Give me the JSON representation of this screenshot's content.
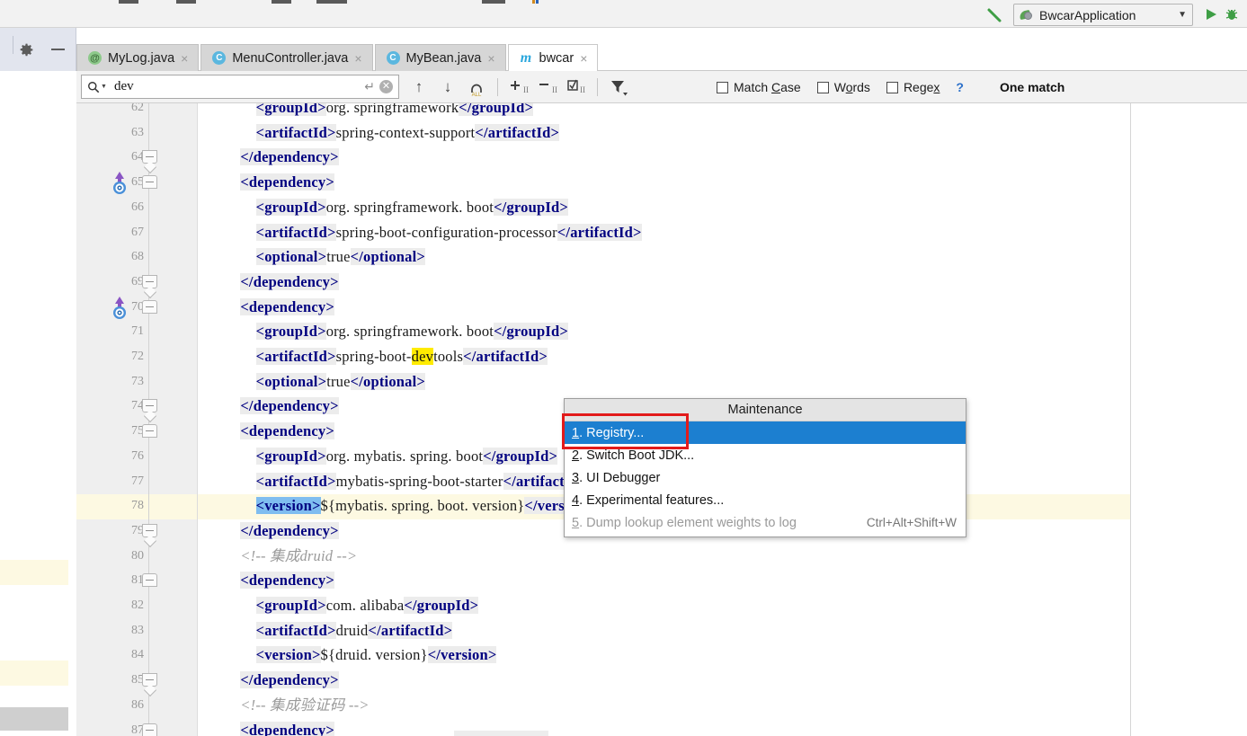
{
  "window": {
    "run_config": "BwcarApplication",
    "run_config_icon": "spring-leaf-icon",
    "hammer_icon": "build-hammer-icon",
    "run_icon": "run-play-icon",
    "debug_icon": "debug-bug-icon",
    "dropdown_icon": "chevron-down-icon"
  },
  "tool_gutter": {
    "settings_icon": "gear-icon",
    "hide_icon": "minimize-icon"
  },
  "tabs": [
    {
      "label": "MyLog.java",
      "icon": "annotation-icon",
      "icon_glyph": "@",
      "icon_kind": "ann",
      "active": false,
      "close": "×"
    },
    {
      "label": "MenuController.java",
      "icon": "class-icon",
      "icon_glyph": "C",
      "icon_kind": "cls",
      "active": false,
      "close": "×"
    },
    {
      "label": "MyBean.java",
      "icon": "class-icon",
      "icon_glyph": "C",
      "icon_kind": "cls",
      "active": false,
      "close": "×"
    },
    {
      "label": "bwcar",
      "icon": "maven-icon",
      "icon_glyph": "m",
      "icon_kind": "mvn",
      "active": true,
      "close": "×"
    }
  ],
  "find": {
    "query": "dev",
    "placeholder": "",
    "search_icon": "search-icon",
    "history_icon": "chevron-down-icon",
    "enter_icon": "enter-return-icon",
    "clear_icon": "clear-close-icon",
    "prev_label": "↑",
    "next_label": "↓",
    "find_all_label": "ALL",
    "buttons": [
      {
        "name": "find-previous-button",
        "glyph": "↑"
      },
      {
        "name": "find-next-button",
        "glyph": "↓"
      },
      {
        "name": "find-all-button",
        "glyph": "⭘"
      },
      {
        "name": "add-selection-button",
        "glyph": "+"
      },
      {
        "name": "remove-selection-button",
        "glyph": "−"
      },
      {
        "name": "select-all-occurrences-button",
        "glyph": "☑"
      },
      {
        "name": "filter-button",
        "glyph": "▼"
      }
    ],
    "options": [
      {
        "label_pre": "Match ",
        "accel": "C",
        "label_post": "ase",
        "checked": false,
        "name": "match-case-checkbox"
      },
      {
        "label_pre": "W",
        "accel": "o",
        "label_post": "rds",
        "checked": false,
        "name": "words-checkbox"
      },
      {
        "label_pre": "Rege",
        "accel": "x",
        "label_post": "",
        "checked": false,
        "name": "regex-checkbox"
      }
    ],
    "help_label": "?",
    "status": "One match"
  },
  "editor": {
    "first_line": 62,
    "lines": [
      {
        "n": 62,
        "parts": [
          {
            "t": "tx",
            "s": "        "
          },
          {
            "t": "tg",
            "s": "<groupId>"
          },
          {
            "t": "tx",
            "s": "org. springframework"
          },
          {
            "t": "tg",
            "s": "</groupId>"
          }
        ]
      },
      {
        "n": 63,
        "parts": [
          {
            "t": "tx",
            "s": "        "
          },
          {
            "t": "tg",
            "s": "<artifactId>"
          },
          {
            "t": "tx",
            "s": "spring-context-support"
          },
          {
            "t": "tg",
            "s": "</artifactId>"
          }
        ]
      },
      {
        "n": 64,
        "fold": "bot",
        "parts": [
          {
            "t": "tx",
            "s": "    "
          },
          {
            "t": "tg",
            "s": "</dependency>"
          }
        ]
      },
      {
        "n": 65,
        "fold": "top",
        "gmark": "spring-bean-marker",
        "parts": [
          {
            "t": "tx",
            "s": "    "
          },
          {
            "t": "tg",
            "s": "<dependency>"
          }
        ]
      },
      {
        "n": 66,
        "parts": [
          {
            "t": "tx",
            "s": "        "
          },
          {
            "t": "tg",
            "s": "<groupId>"
          },
          {
            "t": "tx",
            "s": "org. springframework. boot"
          },
          {
            "t": "tg",
            "s": "</groupId>"
          }
        ]
      },
      {
        "n": 67,
        "parts": [
          {
            "t": "tx",
            "s": "        "
          },
          {
            "t": "tg",
            "s": "<artifactId>"
          },
          {
            "t": "tx",
            "s": "spring-boot-configuration-processor"
          },
          {
            "t": "tg",
            "s": "</artifactId>"
          }
        ]
      },
      {
        "n": 68,
        "parts": [
          {
            "t": "tx",
            "s": "        "
          },
          {
            "t": "tg",
            "s": "<optional>"
          },
          {
            "t": "tx",
            "s": "true"
          },
          {
            "t": "tg",
            "s": "</optional>"
          }
        ]
      },
      {
        "n": 69,
        "fold": "bot",
        "parts": [
          {
            "t": "tx",
            "s": "    "
          },
          {
            "t": "tg",
            "s": "</dependency>"
          }
        ]
      },
      {
        "n": 70,
        "fold": "top",
        "gmark": "spring-bean-marker",
        "parts": [
          {
            "t": "tx",
            "s": "    "
          },
          {
            "t": "tg",
            "s": "<dependency>"
          }
        ]
      },
      {
        "n": 71,
        "parts": [
          {
            "t": "tx",
            "s": "        "
          },
          {
            "t": "tg",
            "s": "<groupId>"
          },
          {
            "t": "tx",
            "s": "org. springframework. boot"
          },
          {
            "t": "tg",
            "s": "</groupId>"
          }
        ]
      },
      {
        "n": 72,
        "parts": [
          {
            "t": "tx",
            "s": "        "
          },
          {
            "t": "tg",
            "s": "<artifactId>"
          },
          {
            "t": "tx",
            "s": "spring-boot-"
          },
          {
            "t": "hitmark",
            "s": "dev"
          },
          {
            "t": "tx",
            "s": "tools"
          },
          {
            "t": "tg",
            "s": "</artifactId>"
          }
        ]
      },
      {
        "n": 73,
        "parts": [
          {
            "t": "tx",
            "s": "        "
          },
          {
            "t": "tg",
            "s": "<optional>"
          },
          {
            "t": "tx",
            "s": "true"
          },
          {
            "t": "tg",
            "s": "</optional>"
          }
        ]
      },
      {
        "n": 74,
        "fold": "bot",
        "parts": [
          {
            "t": "tx",
            "s": "    "
          },
          {
            "t": "tg",
            "s": "</dependency>"
          }
        ]
      },
      {
        "n": 75,
        "fold": "top",
        "parts": [
          {
            "t": "tx",
            "s": "    "
          },
          {
            "t": "tg",
            "s": "<dependency>"
          }
        ]
      },
      {
        "n": 76,
        "parts": [
          {
            "t": "tx",
            "s": "        "
          },
          {
            "t": "tg",
            "s": "<groupId>"
          },
          {
            "t": "tx",
            "s": "org. mybatis. spring. boot"
          },
          {
            "t": "tg",
            "s": "</groupId>"
          }
        ]
      },
      {
        "n": 77,
        "parts": [
          {
            "t": "tx",
            "s": "        "
          },
          {
            "t": "tg",
            "s": "<artifactId>"
          },
          {
            "t": "tx",
            "s": "mybatis-spring-boot-starter"
          },
          {
            "t": "tg",
            "s": "</artifactId>"
          }
        ]
      },
      {
        "n": 78,
        "caret": true,
        "parts": [
          {
            "t": "tx",
            "s": "        "
          },
          {
            "t": "selmark",
            "s": "<version>"
          },
          {
            "t": "tx",
            "s": "${mybatis. spring. boot. version}"
          },
          {
            "t": "tg",
            "s": "</version>"
          }
        ]
      },
      {
        "n": 79,
        "fold": "bot",
        "parts": [
          {
            "t": "tx",
            "s": "    "
          },
          {
            "t": "tg",
            "s": "</dependency>"
          }
        ]
      },
      {
        "n": 80,
        "parts": [
          {
            "t": "tx",
            "s": "    "
          },
          {
            "t": "cm",
            "s": "<!-- 集成druid -->"
          }
        ]
      },
      {
        "n": 81,
        "fold": "top",
        "parts": [
          {
            "t": "tx",
            "s": "    "
          },
          {
            "t": "tg",
            "s": "<dependency>"
          }
        ]
      },
      {
        "n": 82,
        "parts": [
          {
            "t": "tx",
            "s": "        "
          },
          {
            "t": "tg",
            "s": "<groupId>"
          },
          {
            "t": "tx",
            "s": "com. alibaba"
          },
          {
            "t": "tg",
            "s": "</groupId>"
          }
        ]
      },
      {
        "n": 83,
        "parts": [
          {
            "t": "tx",
            "s": "        "
          },
          {
            "t": "tg",
            "s": "<artifactId>"
          },
          {
            "t": "tx",
            "s": "druid"
          },
          {
            "t": "tg",
            "s": "</artifactId>"
          }
        ]
      },
      {
        "n": 84,
        "parts": [
          {
            "t": "tx",
            "s": "        "
          },
          {
            "t": "tg",
            "s": "<version>"
          },
          {
            "t": "tx",
            "s": "${druid. version}"
          },
          {
            "t": "tg",
            "s": "</version>"
          }
        ]
      },
      {
        "n": 85,
        "fold": "bot",
        "parts": [
          {
            "t": "tx",
            "s": "    "
          },
          {
            "t": "tg",
            "s": "</dependency>"
          }
        ]
      },
      {
        "n": 86,
        "parts": [
          {
            "t": "tx",
            "s": "    "
          },
          {
            "t": "cm",
            "s": "<!-- 集成验证码 -->"
          }
        ]
      },
      {
        "n": 87,
        "fold": "top",
        "parts": [
          {
            "t": "tx",
            "s": "    "
          },
          {
            "t": "tg",
            "s": "<dependency>"
          }
        ]
      }
    ]
  },
  "popup": {
    "title": "Maintenance",
    "items": [
      {
        "num": "1",
        "label": ". Registry...",
        "shortcut": "",
        "selected": true,
        "disabled": false,
        "name": "menu-item-registry"
      },
      {
        "num": "2",
        "label": ". Switch Boot JDK...",
        "shortcut": "",
        "selected": false,
        "disabled": false,
        "name": "menu-item-switch-boot-jdk"
      },
      {
        "num": "3",
        "label": ". UI Debugger",
        "shortcut": "",
        "selected": false,
        "disabled": false,
        "name": "menu-item-ui-debugger"
      },
      {
        "num": "4",
        "label": ". Experimental features...",
        "shortcut": "",
        "selected": false,
        "disabled": false,
        "name": "menu-item-experimental-features"
      },
      {
        "num": "5",
        "label": ". Dump lookup element weights to log",
        "shortcut": "Ctrl+Alt+Shift+W",
        "selected": false,
        "disabled": true,
        "name": "menu-item-dump-lookup-weights"
      }
    ]
  },
  "annotation": {
    "highlight_color": "#e21b1b",
    "target": "menu-item-registry"
  },
  "colors": {
    "selection_blue": "#1c7fd0",
    "search_hit_yellow": "#ffeb00",
    "caret_row": "#fdf9e2",
    "tag_navy": "#000080"
  }
}
